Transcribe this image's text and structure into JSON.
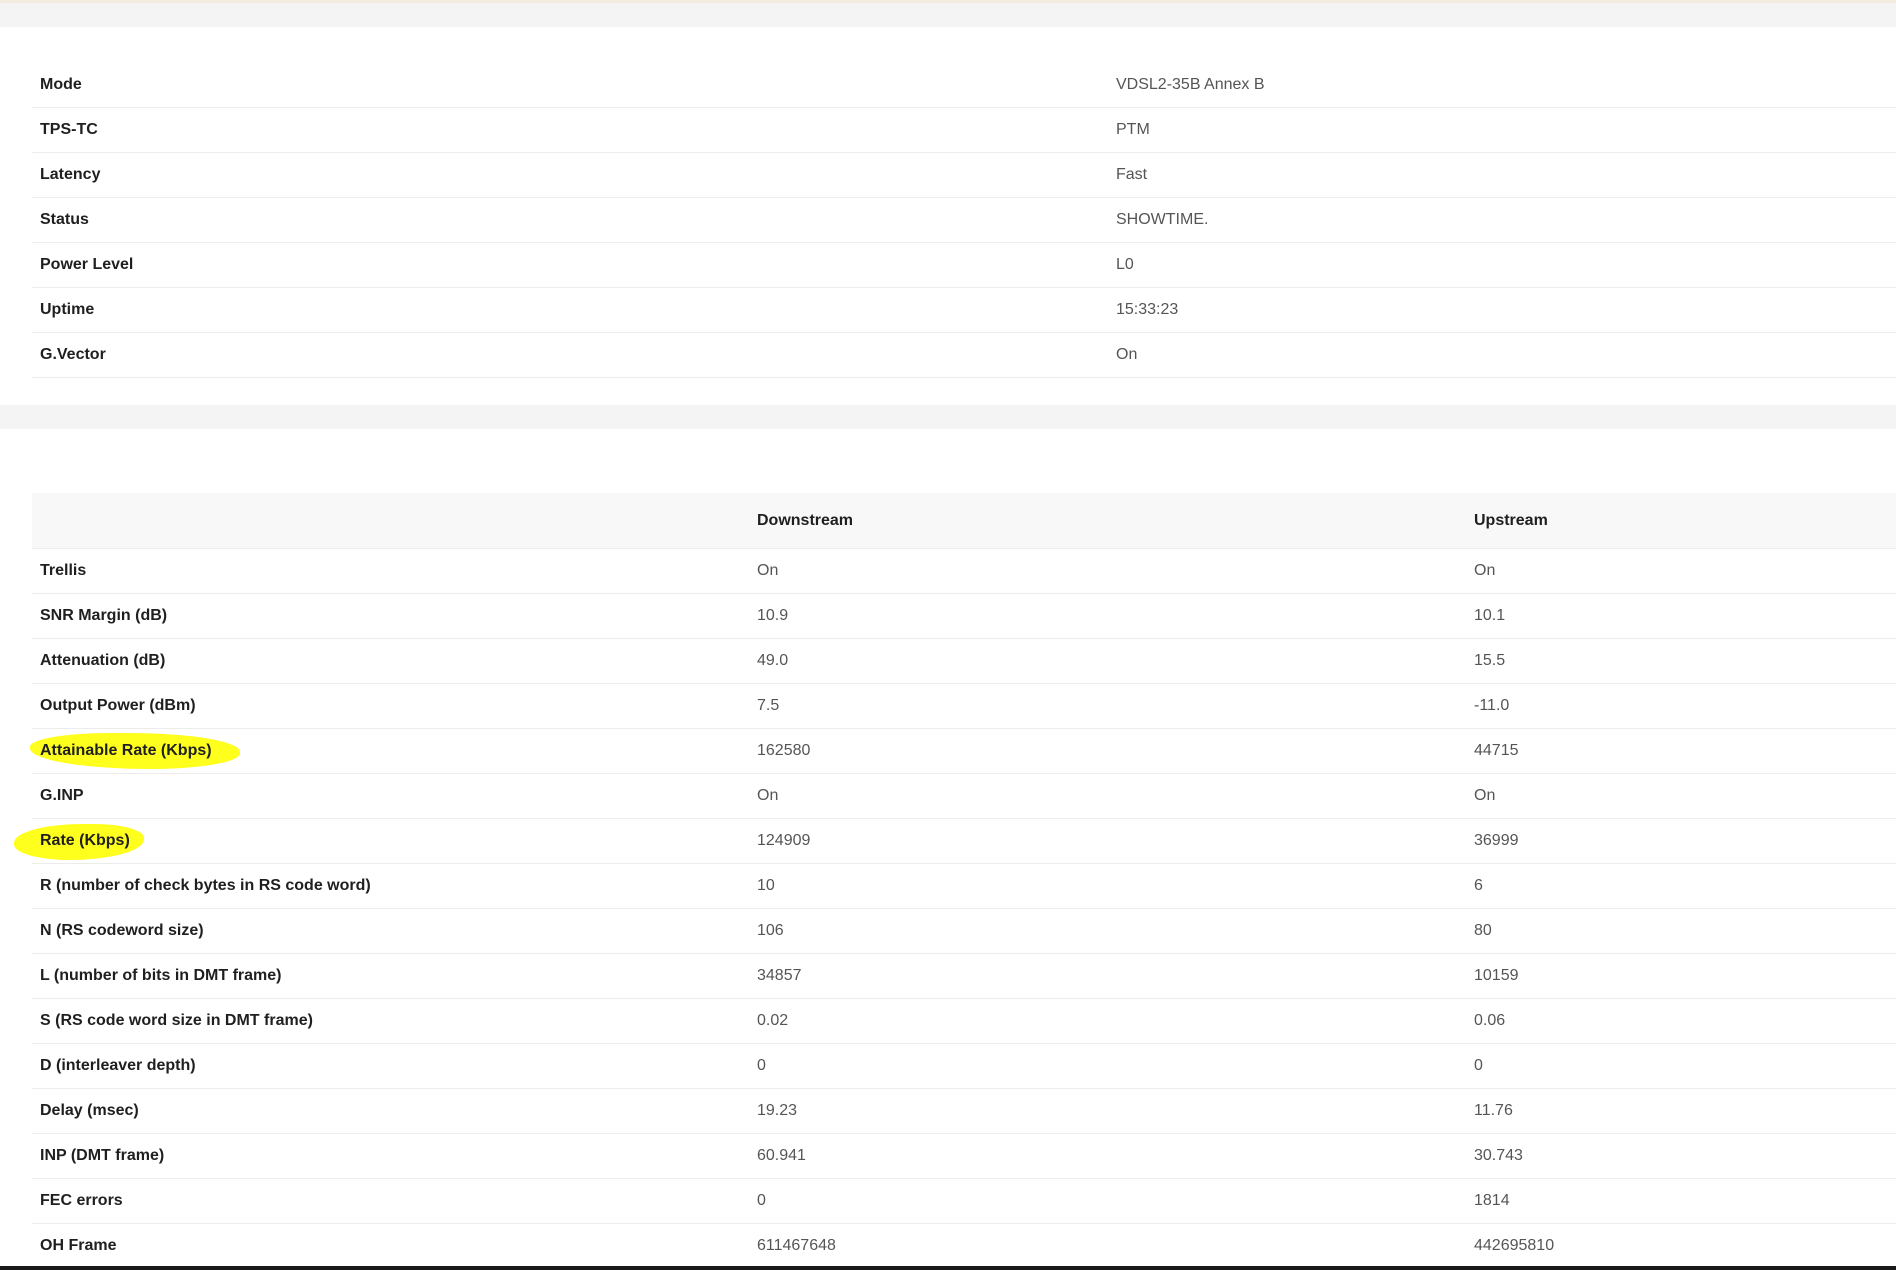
{
  "line_info": {
    "rows": [
      {
        "label": "Mode",
        "value": "VDSL2-35B Annex B"
      },
      {
        "label": "TPS-TC",
        "value": "PTM"
      },
      {
        "label": "Latency",
        "value": "Fast"
      },
      {
        "label": "Status",
        "value": "SHOWTIME."
      },
      {
        "label": "Power Level",
        "value": "L0"
      },
      {
        "label": "Uptime",
        "value": "15:33:23"
      },
      {
        "label": "G.Vector",
        "value": "On"
      }
    ]
  },
  "stats": {
    "headers": [
      "",
      "Downstream",
      "Upstream"
    ],
    "rows": [
      {
        "label": "Trellis",
        "down": "On",
        "up": "On"
      },
      {
        "label": "SNR Margin (dB)",
        "down": "10.9",
        "up": "10.1"
      },
      {
        "label": "Attenuation (dB)",
        "down": "49.0",
        "up": "15.5"
      },
      {
        "label": "Output Power (dBm)",
        "down": "7.5",
        "up": "-11.0"
      },
      {
        "label": "Attainable Rate (Kbps)",
        "down": "162580",
        "up": "44715"
      },
      {
        "label": "G.INP",
        "down": "On",
        "up": "On"
      },
      {
        "label": "Rate (Kbps)",
        "down": "124909",
        "up": "36999"
      },
      {
        "label": "R (number of check bytes in RS code word)",
        "down": "10",
        "up": "6"
      },
      {
        "label": "N (RS codeword size)",
        "down": "106",
        "up": "80"
      },
      {
        "label": "L (number of bits in DMT frame)",
        "down": "34857",
        "up": "10159"
      },
      {
        "label": "S (RS code word size in DMT frame)",
        "down": "0.02",
        "up": "0.06"
      },
      {
        "label": "D (interleaver depth)",
        "down": "0",
        "up": "0"
      },
      {
        "label": "Delay (msec)",
        "down": "19.23",
        "up": "11.76"
      },
      {
        "label": "INP (DMT frame)",
        "down": "60.941",
        "up": "30.743"
      },
      {
        "label": "FEC errors",
        "down": "0",
        "up": "1814"
      },
      {
        "label": "OH Frame",
        "down": "611467648",
        "up": "442695810"
      }
    ]
  },
  "colors": {
    "highlight": "#ffff1e",
    "page_bg": "#f4f4f4",
    "card_bg": "#ffffff"
  }
}
